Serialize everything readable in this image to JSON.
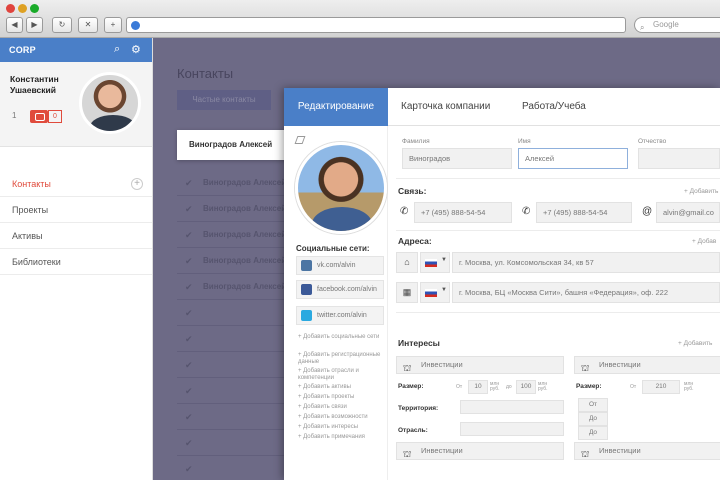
{
  "browser": {
    "search_placeholder": "Google",
    "buttons": {
      "back": "◀",
      "forward": "▶",
      "reload": "↻",
      "share": "✕",
      "add": "+"
    }
  },
  "sidebar": {
    "logo": "CORP",
    "user_name": "Константин Ушаевский",
    "message_count": "0",
    "badge_count": "1",
    "items": [
      {
        "label": "Контакты",
        "active": true
      },
      {
        "label": "Проекты"
      },
      {
        "label": "Активы"
      },
      {
        "label": "Библиотеки"
      }
    ]
  },
  "background": {
    "title": "Контакты",
    "button_label": "Частые контакты",
    "selected_contact": "Виноградов Алексей",
    "rows": [
      "Виноградов Алексей",
      "Виноградов Алексей",
      "Виноградов Алексей",
      "Виноградов Алексей",
      "Виноградов Алексей"
    ]
  },
  "panel": {
    "tabs": [
      "Редактирование",
      "Карточка компании",
      "Работа/Учеба"
    ],
    "social_title": "Социальные сети:",
    "social": [
      {
        "name": "vk",
        "value": "vk.com/alvin",
        "color": "#4c75a3"
      },
      {
        "name": "facebook",
        "value": "facebook.com/alvin",
        "color": "#3b5998"
      },
      {
        "name": "twitter",
        "value": "twitter.com/alvin",
        "color": "#2aa9e0"
      }
    ],
    "add_links": [
      "Добавить социальные сети",
      "Добавить регистрационные данные",
      "Добавить отрасли и компетенции",
      "Добавить активы",
      "Добавить проекты",
      "Добавить связи",
      "Добавить возможности",
      "Добавить интересы",
      "Добавить примечания"
    ],
    "name_fields": {
      "surname_label": "Фамилия",
      "surname": "Виноградов",
      "name_label": "Имя",
      "name": "Алексей",
      "patronymic_label": "Отчество",
      "patronymic": ""
    },
    "contacts": {
      "title": "Связь:",
      "add": "+ Добавить",
      "phone1": "+7 (495) 888-54-54",
      "phone2": "+7 (495) 888-54-54",
      "email": "alvin@gmail.co"
    },
    "addresses": {
      "title": "Адреса:",
      "add": "+ Добав",
      "home": "г. Москва, ул. Комсомольская 34, кв 57",
      "work": "г. Москва, БЦ «Москва Сити», башня «Федерация», оф. 222"
    },
    "interests": {
      "title": "Интересы",
      "add": "+ Добавить",
      "box1_title": "Инвестиции",
      "box2_title": "Инвестиции",
      "size_label": "Размер:",
      "from": "От",
      "to": "до",
      "unit": "млн руб.",
      "from_value": "10",
      "to_value": "100",
      "from_value2": "210",
      "territory_label": "Территория:",
      "industry_label": "Отрасль:",
      "from_short": "От",
      "to_short": "До",
      "to_short2": "До",
      "box3_title": "Инвестиции",
      "box4_title": "Инвестиции"
    }
  }
}
